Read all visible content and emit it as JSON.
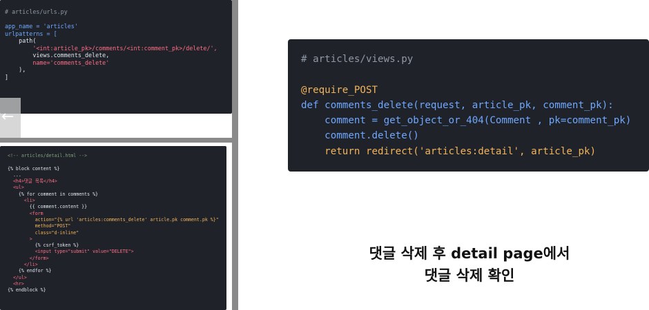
{
  "urls_panel": {
    "lines": [
      "# articles/urls.py",
      "",
      "app_name = 'articles'",
      "urlpatterns = [",
      "    path(",
      "        '<int:article_pk>/comments/<int:comment_pk>/delete/',",
      "        views.comments_delete,",
      "        name='comments_delete'",
      "    ),",
      "]"
    ]
  },
  "detail_panel": {
    "lines": [
      "<!-- articles/detail.html -->",
      "",
      "{% block content %}",
      "  ...",
      "  <h4>댓글 목록</h4>",
      "  <ul>",
      "    {% for comment in comments %}",
      "      <li>",
      "        {{ comment.content }}",
      "        <form",
      "          action=\"{% url 'articles:comments_delete' article.pk comment.pk %}\"",
      "          method=\"POST\"",
      "          class=\"d-inline\"",
      "        >",
      "          {% csrf_token %}",
      "          <input type=\"submit\" value=\"DELETE\">",
      "        </form>",
      "      </li>",
      "    {% endfor %}",
      "  </ul>",
      "  <hr>",
      "{% endblock %}"
    ]
  },
  "views_panel": {
    "lines": [
      "# articles/views.py",
      "",
      "@require_POST",
      "def comments_delete(request, article_pk, comment_pk):",
      "    comment = get_object_or_404(Comment , pk=comment_pk)",
      "    comment.delete()",
      "    return redirect('articles:detail', article_pk)"
    ]
  },
  "caption": {
    "line1": "댓글 삭제 후 detail page에서",
    "line2": "댓글 삭제 확인"
  },
  "nav": {
    "back_arrow": "←"
  }
}
